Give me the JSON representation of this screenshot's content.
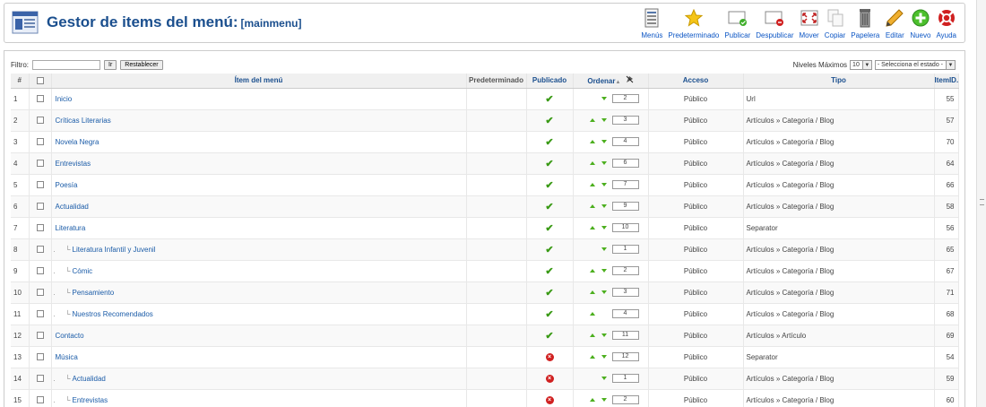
{
  "header": {
    "title": "Gestor de items del menú:",
    "subtitle": "[mainmenu]"
  },
  "toolbar": [
    {
      "label": "Menús",
      "icon": "menus-icon"
    },
    {
      "label": "Predeterminado",
      "icon": "star-icon"
    },
    {
      "label": "Publicar",
      "icon": "publish-icon"
    },
    {
      "label": "Despublicar",
      "icon": "unpublish-icon"
    },
    {
      "label": "Mover",
      "icon": "move-icon"
    },
    {
      "label": "Copiar",
      "icon": "copy-icon"
    },
    {
      "label": "Papelera",
      "icon": "trash-icon"
    },
    {
      "label": "Editar",
      "icon": "edit-icon"
    },
    {
      "label": "Nuevo",
      "icon": "new-icon"
    },
    {
      "label": "Ayuda",
      "icon": "help-icon"
    }
  ],
  "filter": {
    "label": "Filtro:",
    "value": "",
    "go_label": "Ir",
    "reset_label": "Restablecer",
    "levels_label": "Niveles Máximos",
    "levels_value": "10",
    "state_value": "- Selecciona el estado -"
  },
  "columns": {
    "num": "#",
    "item": "Ítem del menú",
    "default": "Predeterminado",
    "published": "Publicado",
    "order": "Ordenar",
    "access": "Acceso",
    "type": "Tipo",
    "itemid": "ItemID."
  },
  "rows": [
    {
      "num": "1",
      "title": "Inicio",
      "level": 0,
      "published": true,
      "up": false,
      "down": true,
      "order": "2",
      "access": "Público",
      "type": "Url",
      "itemid": "55"
    },
    {
      "num": "2",
      "title": "Críticas Literarias",
      "level": 0,
      "published": true,
      "up": true,
      "down": true,
      "order": "3",
      "access": "Público",
      "type": "Artículos » Categoría / Blog",
      "itemid": "57"
    },
    {
      "num": "3",
      "title": "Novela Negra",
      "level": 0,
      "published": true,
      "up": true,
      "down": true,
      "order": "4",
      "access": "Público",
      "type": "Artículos » Categoría / Blog",
      "itemid": "70"
    },
    {
      "num": "4",
      "title": "Entrevistas",
      "level": 0,
      "published": true,
      "up": true,
      "down": true,
      "order": "6",
      "access": "Público",
      "type": "Artículos » Categoría / Blog",
      "itemid": "64"
    },
    {
      "num": "5",
      "title": "Poesía",
      "level": 0,
      "published": true,
      "up": true,
      "down": true,
      "order": "7",
      "access": "Público",
      "type": "Artículos » Categoría / Blog",
      "itemid": "66"
    },
    {
      "num": "6",
      "title": "Actualidad",
      "level": 0,
      "published": true,
      "up": true,
      "down": true,
      "order": "9",
      "access": "Público",
      "type": "Artículos » Categoría / Blog",
      "itemid": "58"
    },
    {
      "num": "7",
      "title": "Literatura",
      "level": 0,
      "published": true,
      "up": true,
      "down": true,
      "order": "10",
      "access": "Público",
      "type": "Separator",
      "itemid": "56"
    },
    {
      "num": "8",
      "title": "Literatura Infantil y Juvenil",
      "level": 1,
      "published": true,
      "up": false,
      "down": true,
      "order": "1",
      "access": "Público",
      "type": "Artículos » Categoría / Blog",
      "itemid": "65"
    },
    {
      "num": "9",
      "title": "Cómic",
      "level": 1,
      "published": true,
      "up": true,
      "down": true,
      "order": "2",
      "access": "Público",
      "type": "Artículos » Categoría / Blog",
      "itemid": "67"
    },
    {
      "num": "10",
      "title": "Pensamiento",
      "level": 1,
      "published": true,
      "up": true,
      "down": true,
      "order": "3",
      "access": "Público",
      "type": "Artículos » Categoría / Blog",
      "itemid": "71"
    },
    {
      "num": "11",
      "title": "Nuestros Recomendados",
      "level": 1,
      "published": true,
      "up": true,
      "down": false,
      "order": "4",
      "access": "Público",
      "type": "Artículos » Categoría / Blog",
      "itemid": "68"
    },
    {
      "num": "12",
      "title": "Contacto",
      "level": 0,
      "published": true,
      "up": true,
      "down": true,
      "order": "11",
      "access": "Público",
      "type": "Artículos » Artículo",
      "itemid": "69"
    },
    {
      "num": "13",
      "title": "Música",
      "level": 0,
      "published": false,
      "up": true,
      "down": true,
      "order": "12",
      "access": "Público",
      "type": "Separator",
      "itemid": "54"
    },
    {
      "num": "14",
      "title": "Actualidad",
      "level": 1,
      "published": false,
      "up": false,
      "down": true,
      "order": "1",
      "access": "Público",
      "type": "Artículos » Categoría / Blog",
      "itemid": "59"
    },
    {
      "num": "15",
      "title": "Entrevistas",
      "level": 1,
      "published": false,
      "up": true,
      "down": true,
      "order": "2",
      "access": "Público",
      "type": "Artículos » Categoría / Blog",
      "itemid": "60"
    }
  ],
  "colors": {
    "title": "#1b4f8e",
    "link": "#1b5ca8",
    "access": "#2e8b1e",
    "published": "#3a9a16",
    "unpublished": "#d02020"
  }
}
